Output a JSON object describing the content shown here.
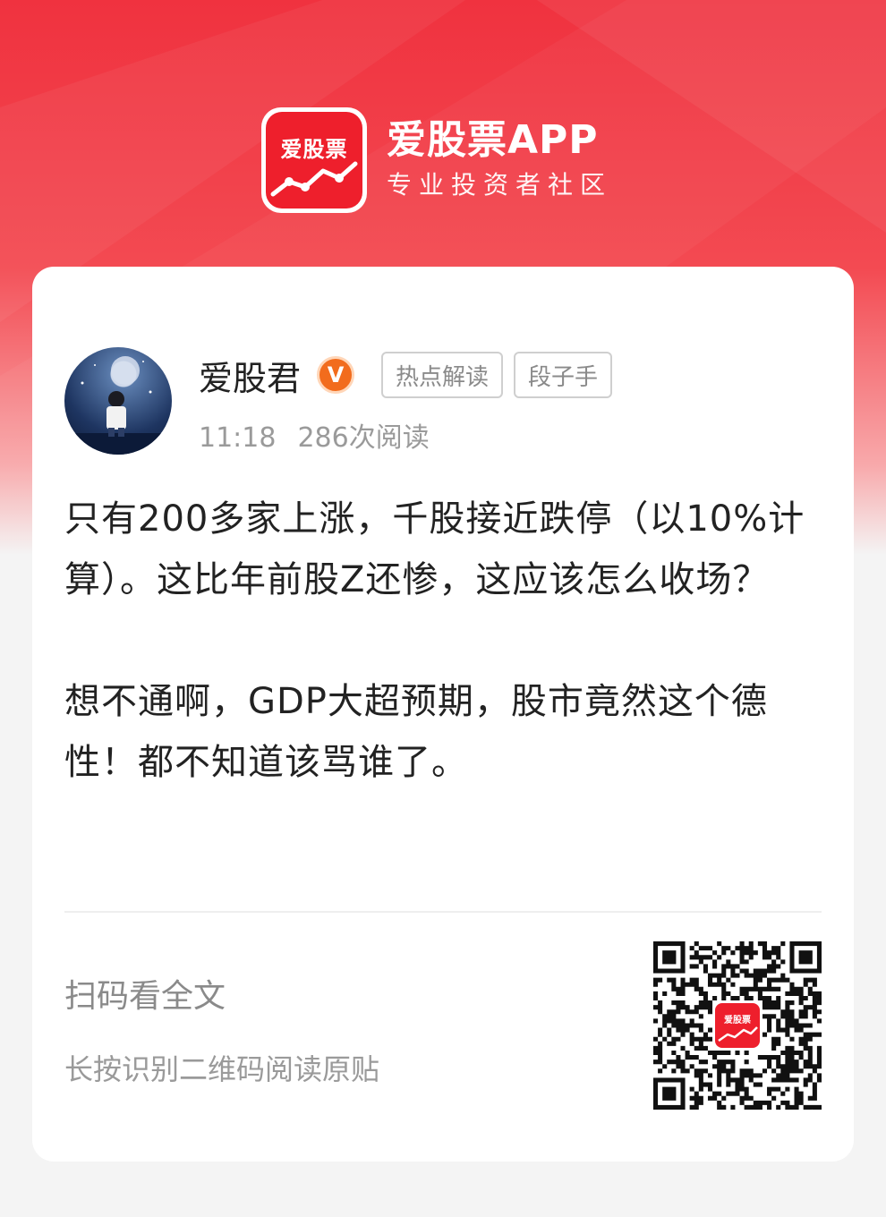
{
  "brand": {
    "logo_text": "爱股票",
    "name": "爱股票APP",
    "slogan": "专业投资者社区"
  },
  "post": {
    "author": "爱股君",
    "verified_badge": "V",
    "tags": [
      "热点解读",
      "段子手"
    ],
    "time": "11:18",
    "reads": "286次阅读",
    "paragraphs": [
      "只有200多家上涨，千股接近跌停（以10%计算）。这比年前股Z还惨，这应该怎么收场？",
      "想不通啊，GDP大超预期，股市竟然这个德性！都不知道该骂谁了。"
    ]
  },
  "footer": {
    "scan_title": "扫码看全文",
    "scan_sub": "长按识别二维码阅读原贴",
    "qr_logo_text": "爱股票"
  },
  "colors": {
    "brand_red": "#ee1f2c",
    "badge_orange": "#f26c1d"
  }
}
